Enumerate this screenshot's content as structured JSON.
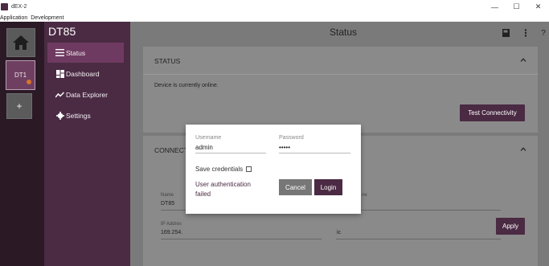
{
  "window": {
    "title": "dEX-2",
    "minimize": "—",
    "maximize": "☐",
    "close": "✕"
  },
  "menu": [
    "Application",
    "Development"
  ],
  "rail": {
    "device_tile": "DT1",
    "add_label": "+"
  },
  "sidebar": {
    "device_title": "DT85",
    "items": [
      {
        "label": "Status",
        "icon": "list-icon"
      },
      {
        "label": "Dashboard",
        "icon": "dashboard-icon"
      },
      {
        "label": "Data Explorer",
        "icon": "chart-icon"
      },
      {
        "label": "Settings",
        "icon": "gear-icon"
      }
    ]
  },
  "header": {
    "title": "Status",
    "icons": [
      "notebook-icon",
      "more-vertical-icon",
      "help-icon"
    ]
  },
  "status_card": {
    "heading": "STATUS",
    "message": "Device is currently online.",
    "test_button": "Test Connectivity"
  },
  "connection_card": {
    "heading": "CONNECT",
    "name_label": "Name",
    "name_value": "DT85",
    "right_label": "ne",
    "ip_label": "IP Addres",
    "ip_value": "169.254.",
    "right_value": "ic",
    "apply_button": "Apply"
  },
  "login_dialog": {
    "username_label": "Username",
    "username_value": "admin",
    "password_label": "Password",
    "password_value": "•••••",
    "save_label": "Save credentials",
    "error": "User authentication failed",
    "cancel_button": "Cancel",
    "login_button": "Login"
  },
  "colors": {
    "brand": "#4a2b43",
    "active": "#6f3a61",
    "alert": "#d8742c"
  }
}
